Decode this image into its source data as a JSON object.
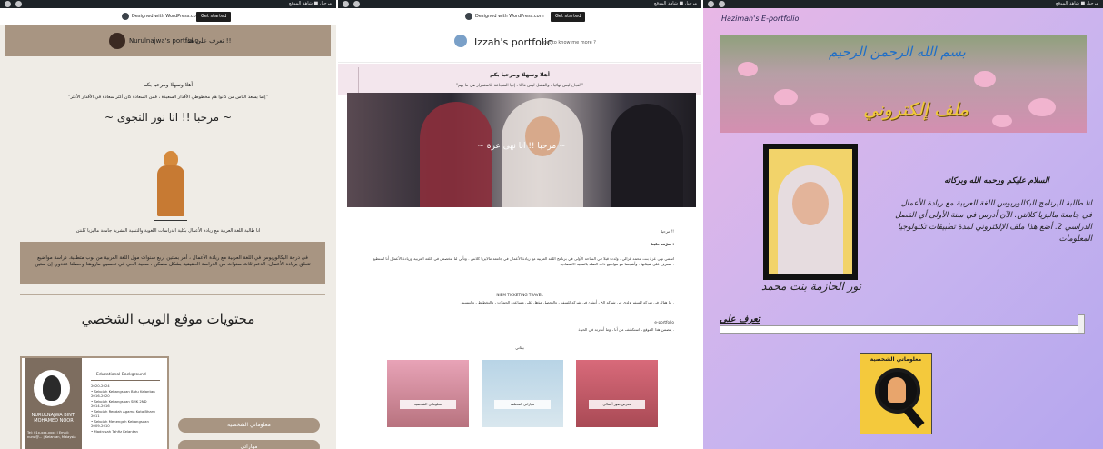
{
  "colors": {
    "admin_bar": "#1d2327",
    "panel1_accent": "#a89582",
    "panel1_bg": "#efece6",
    "panel2_banner": "#f3e6ed",
    "panel3_gradient_start": "#e9b7e6",
    "panel3_gradient_end": "#b5a6ee",
    "gold": "#f0c93a"
  },
  "panel1": {
    "admin_right": "مرحبا، ■ شاهد الموقع",
    "notice_text": "Designed with WordPress.com",
    "notice_button": "Get started",
    "site_title": "Nurulnajwa's portfolio",
    "nav": "تعرف على هذا !!",
    "greeting": "أهلا وسهلا ومرحبا بكم",
    "quote": "\"إنما يسعد الناس من كانوا هم مخطوطي الأقدار السعيدة ، فمن السعادة كان أكثر سعادة في الأقدار الأكثر\"",
    "title": "~ مرحبا !! انا نور النجوى ~",
    "desc": "انا طالبة اللغة العربية مع ريادة الأعمال بكلية الدراسات اللغوية والتنمية البشرية جامعة ماليزيا كلنتن",
    "box_text": "في درجة البكالوريوس في اللغة العربية مع ريادة الأعمال ، أمر بستين أربع سنوات مول اللغة العربية من نوب متطلبة. دراسة مواضيع تتعلق بريادة الأعمال. الدعم ثلاث سنوات من الدراسة الحقيقية بشكل متمكن ، سعيد الحي في تحسين ماروهنا وحصلنا عددوي إن ستين",
    "section_title": "محتويات موقع الويب الشخصي",
    "card": {
      "name": "NURULNAJWA BINTI MOHAMED NOOR",
      "info": "Tel: 01x-xxx-xxxx | Email: nurul@... | Kelantan, Malaysia",
      "edu_title": "Educational Background",
      "edu_list": [
        "2020-2024",
        "• Sekolah Kebangsaan Batu Kelantan",
        "2016-2020",
        "• Sekolah Kebangsaan SMK 2ND",
        "2014-2016",
        "• Sekolah Rendah Agama Kota Bharu",
        "2011",
        "• Sekolah Menengah Kebangsaan",
        "2009-2010",
        "• Madrasah Tahfiz Kelantan"
      ]
    },
    "pills": [
      "معلوماتي الشخصية",
      "مهاراتي"
    ]
  },
  "panel2": {
    "admin_right": "مرحبا، ■ شاهد الموقع",
    "notice_text": "Designed with WordPress.com",
    "notice_button": "Get started",
    "site_title": "Izzah's portfolio",
    "nav": "get to know me more ?",
    "banner_title": "أهلا وسهلا ومرحبا بكم",
    "banner_quote": "\"النجاح ليس نهائيا ، والفشل ليس قاتلا ، إنها الشجاعة للاستمرار هي ما يهم\"",
    "hero_title": "~ مرحبا !! انا نهى عزة ~",
    "content_lines": [
      "مرحبا !!",
      "تعرّف علينا :",
      "اسمي نهى عزة بنت محمد غزالي . ولدت قبلا في الساحة الأولى في برنامج اللغة العربية مع ريادة الأعمال في جامعة مالايزيا كلانتن . وتأتي لنا لتخصص في اللغة العربية وريادة الأعمال أنا استطيع متعرف على شيئاتها . وأشجعنا مع مواضيع ذات الصلة بالتنمية الاقتصادية .",
      "NIEM TICKETING TRAVEL",
      "أنا هناك في شركة للسفر ولدي في شركة الخ ، أنشئ في شركة للسفر ، والتحصل مؤهل على مساعدة الحملات ، والتخطيط ، والتنسيق .",
      "e-portfolio",
      "يتضمن هذا الموقع ، استكشف من أنا ، وما أنجزته في الحياة ."
    ],
    "cards_label": "بيئاتي",
    "tiles": [
      "معلوماتي الشخصية",
      "مهاراتي المختلفة",
      "معرض صور أعمالي"
    ]
  },
  "panel3": {
    "admin_right": "مرحبا، ■ شاهد الموقع",
    "site_title": "Hazimah's E-portfolio",
    "basmala": "بسم الله الرحمن الرحيم",
    "gold_title": "ملف إلكتروني",
    "signature": "نور الحازمة بنت محمد",
    "salam": "السلام عليكم ورحمه الله وبركاته",
    "intro": "انا طالبة البرنامج البكالوريوس اللغة العربية مع ريادة الأعمال في جامعة ماليزيا كلانتن. الآن أدرس في سنة الأولى أي الفصل الدراسي 2. أضع هذا ملف الإلكتروني لمدة تطبيقات تكنولوجيا المعلومات",
    "know_me": "تعرف علي",
    "info_label": "معلوماتي الشخصية"
  }
}
